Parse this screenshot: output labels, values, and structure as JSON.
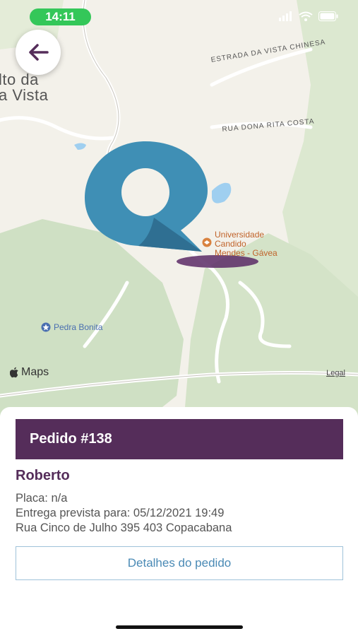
{
  "status_bar": {
    "time": "14:11",
    "icons": [
      "signal-icon",
      "wifi-icon",
      "battery-icon"
    ]
  },
  "map": {
    "place_name_line1": "lto da",
    "place_name_line2": "a Vista",
    "roads": [
      "ESTRADA DA VISTA CHINESA",
      "RUA DONA RITA COSTA"
    ],
    "poi_university_line1": "Universidade",
    "poi_university_line2": "Candido",
    "poi_university_line3": "Mendes - Gávea",
    "poi_park": "Pedra Bonita",
    "attribution": "Maps",
    "legal": "Legal"
  },
  "order": {
    "header": "Pedido #138",
    "customer_name": "Roberto",
    "plate": "Placa: n/a",
    "delivery": "Entrega prevista para: 05/12/2021 19:49",
    "address": "Rua Cinco de Julho 395 403 Copacabana",
    "details_button": "Detalhes do pedido"
  },
  "colors": {
    "brand_purple": "#552d5a",
    "marker_blue": "#3f8fb5",
    "status_green": "#34c759"
  }
}
